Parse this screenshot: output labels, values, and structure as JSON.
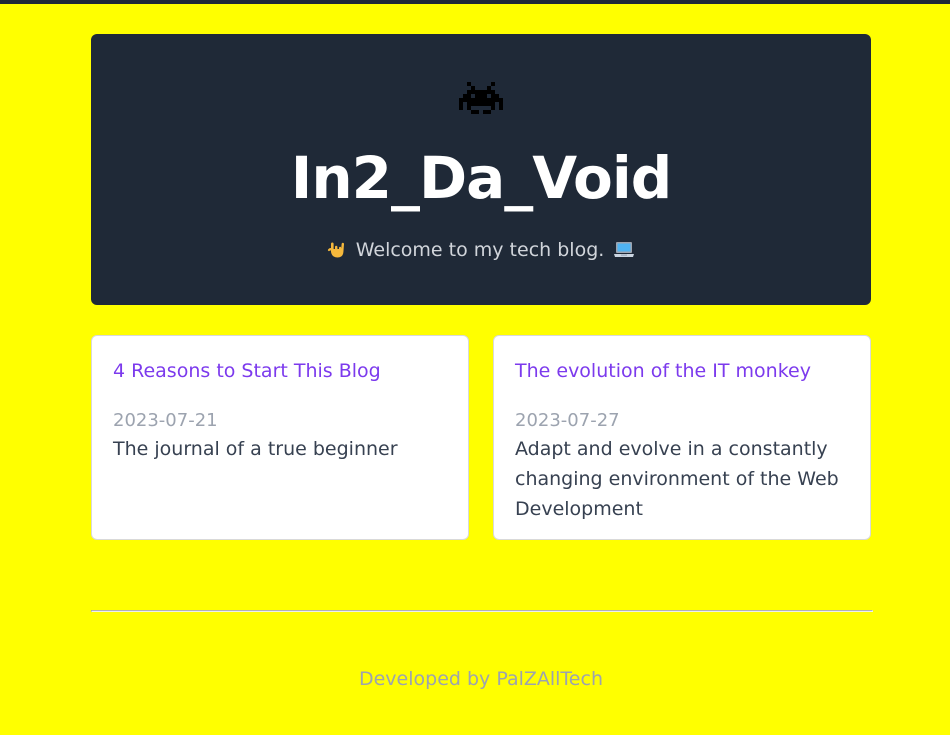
{
  "header": {
    "icon": "space-invader-icon",
    "title": "In2_Da_Void",
    "subtitle": "Welcome to my tech blog.",
    "subtitle_icons": [
      "rock-on-hand-icon",
      "laptop-icon"
    ]
  },
  "posts": [
    {
      "title": "4 Reasons to Start This Blog",
      "date": "2023-07-21",
      "description": "The journal of a true beginner"
    },
    {
      "title": "The evolution of the IT monkey",
      "date": "2023-07-27",
      "description": "Adapt and evolve in a constantly changing environment of the Web Development"
    }
  ],
  "footer": {
    "text": "Developed by PalZAllTech"
  },
  "colors": {
    "background": "#ffff00",
    "hero": "#1f2937",
    "link": "#7c3aed",
    "muted": "#9ca3af"
  }
}
